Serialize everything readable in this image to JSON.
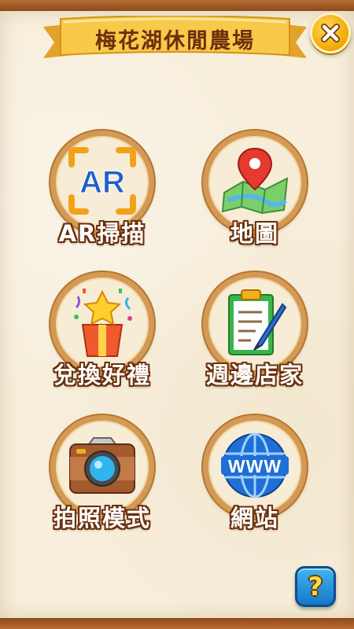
{
  "header": {
    "title": "梅花湖休閒農場",
    "close_icon": "close-icon"
  },
  "menu": {
    "items": [
      {
        "id": "ar-scan",
        "label": "AR掃描",
        "icon": "ar-scan-icon"
      },
      {
        "id": "map",
        "label": "地圖",
        "icon": "map-pin-icon"
      },
      {
        "id": "redeem-gifts",
        "label": "兌換好禮",
        "icon": "gift-box-icon"
      },
      {
        "id": "nearby-shops",
        "label": "週邊店家",
        "icon": "clipboard-icon"
      },
      {
        "id": "photo-mode",
        "label": "拍照模式",
        "icon": "camera-icon"
      },
      {
        "id": "website",
        "label": "網站",
        "icon": "globe-www-icon"
      }
    ]
  },
  "help": {
    "label": "?",
    "icon": "help-icon"
  },
  "colors": {
    "ribbon": "#f8c94a",
    "label_outline": "#6b2f0c",
    "frame": "#a25c28",
    "help_button": "#2591dd",
    "close_button": "#f5b20a"
  }
}
